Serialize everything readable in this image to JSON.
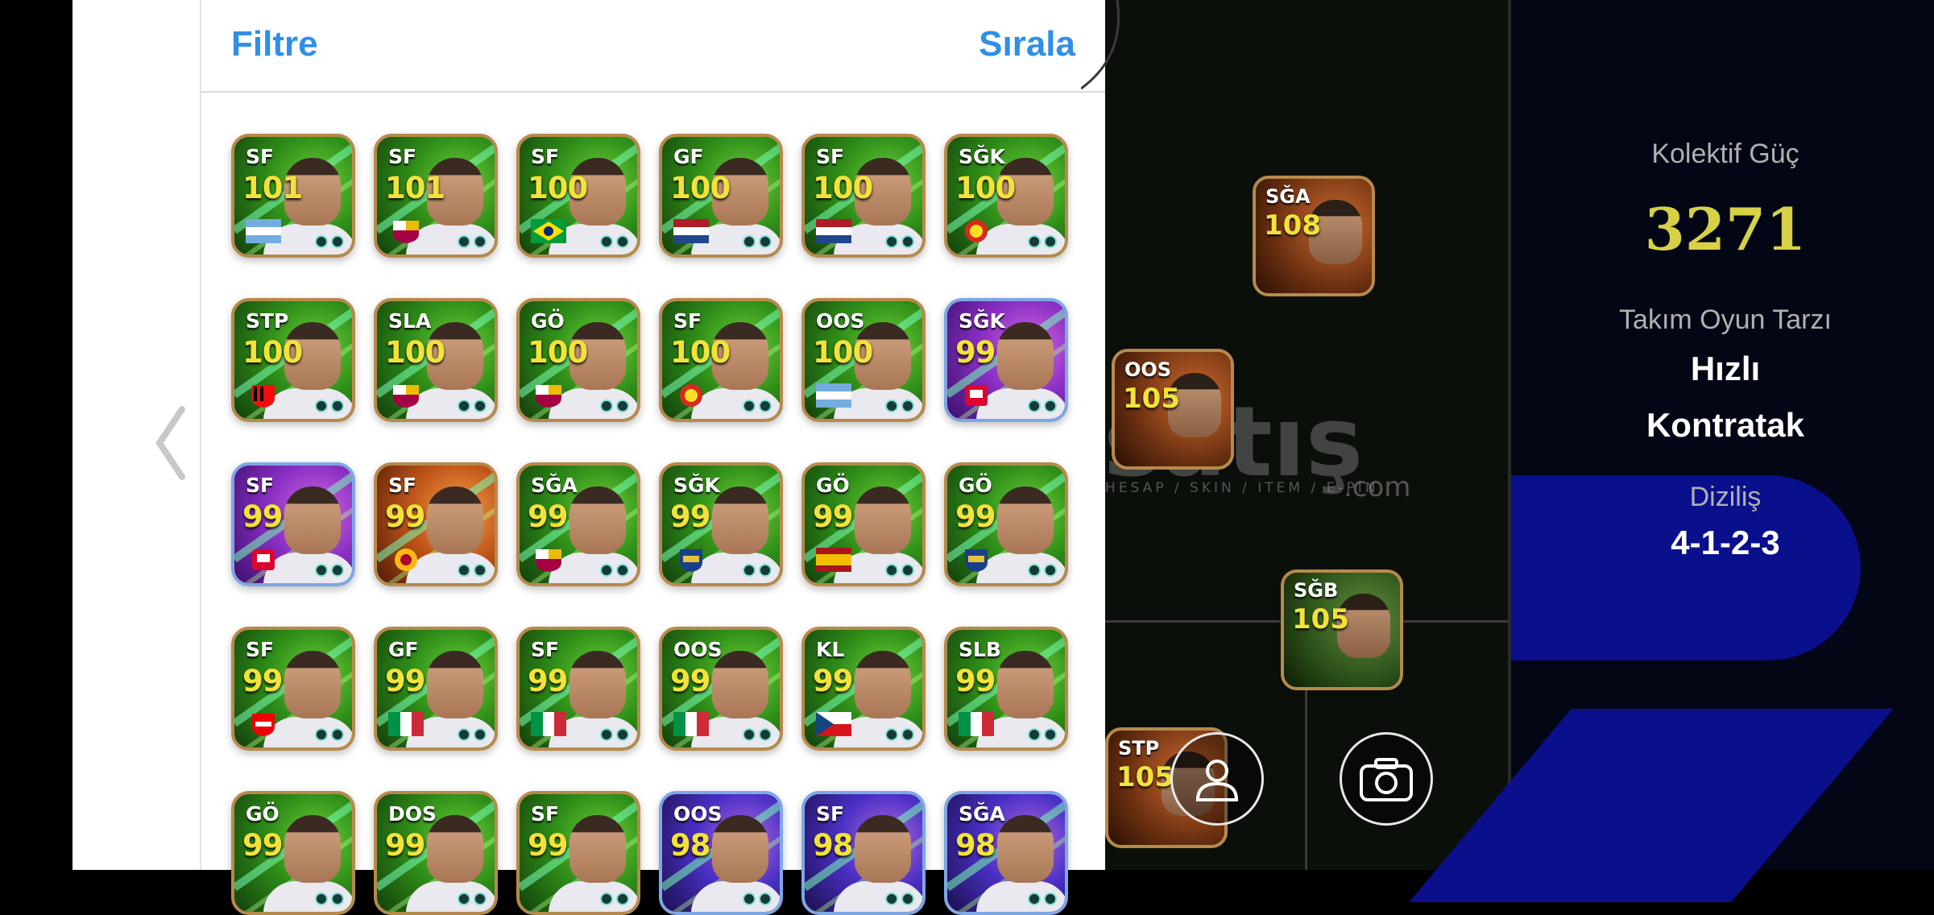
{
  "header": {
    "filter_label": "Filtre",
    "sort_label": "Sırala"
  },
  "players": [
    {
      "pos": "SF",
      "rating": "101",
      "style": "green",
      "flag": "argentina"
    },
    {
      "pos": "SF",
      "rating": "101",
      "style": "green",
      "flag": "barcelona"
    },
    {
      "pos": "SF",
      "rating": "100",
      "style": "green",
      "flag": "brazil"
    },
    {
      "pos": "GF",
      "rating": "100",
      "style": "green",
      "flag": "netherlands"
    },
    {
      "pos": "SF",
      "rating": "100",
      "style": "green",
      "flag": "netherlands"
    },
    {
      "pos": "SĞK",
      "rating": "100",
      "style": "green",
      "flag": "manutd"
    },
    {
      "pos": "STP",
      "rating": "100",
      "style": "green",
      "flag": "milan"
    },
    {
      "pos": "SLA",
      "rating": "100",
      "style": "green",
      "flag": "barcelona"
    },
    {
      "pos": "GÖ",
      "rating": "100",
      "style": "green",
      "flag": "barcelona"
    },
    {
      "pos": "SF",
      "rating": "100",
      "style": "green",
      "flag": "manutd"
    },
    {
      "pos": "OOS",
      "rating": "100",
      "style": "green",
      "flag": "argentina"
    },
    {
      "pos": "SĞK",
      "rating": "99",
      "style": "purple",
      "flag": "bayern"
    },
    {
      "pos": "SF",
      "rating": "99",
      "style": "purple",
      "flag": "bayern"
    },
    {
      "pos": "SF",
      "rating": "99",
      "style": "orange",
      "flag": "galatasaray"
    },
    {
      "pos": "SĞA",
      "rating": "99",
      "style": "green",
      "flag": "barcelona"
    },
    {
      "pos": "SĞK",
      "rating": "99",
      "style": "green",
      "flag": "club"
    },
    {
      "pos": "GÖ",
      "rating": "99",
      "style": "green",
      "flag": "spain"
    },
    {
      "pos": "GÖ",
      "rating": "99",
      "style": "green",
      "flag": "club"
    },
    {
      "pos": "SF",
      "rating": "99",
      "style": "green",
      "flag": "arsenal"
    },
    {
      "pos": "GF",
      "rating": "99",
      "style": "green",
      "flag": "italy"
    },
    {
      "pos": "SF",
      "rating": "99",
      "style": "green",
      "flag": "italy"
    },
    {
      "pos": "OOS",
      "rating": "99",
      "style": "green",
      "flag": "italy"
    },
    {
      "pos": "KL",
      "rating": "99",
      "style": "green",
      "flag": "czech"
    },
    {
      "pos": "SLB",
      "rating": "99",
      "style": "green",
      "flag": "italy"
    },
    {
      "pos": "GÖ",
      "rating": "99",
      "style": "green",
      "flag": "none"
    },
    {
      "pos": "DOS",
      "rating": "99",
      "style": "green",
      "flag": "none"
    },
    {
      "pos": "SF",
      "rating": "99",
      "style": "green",
      "flag": "none"
    },
    {
      "pos": "OOS",
      "rating": "98",
      "style": "blue",
      "flag": "none"
    },
    {
      "pos": "SF",
      "rating": "98",
      "style": "blue",
      "flag": "none"
    },
    {
      "pos": "SĞA",
      "rating": "98",
      "style": "blue",
      "flag": "none"
    }
  ],
  "pitch": {
    "cards": [
      {
        "pos": "SĞA",
        "rating": "108",
        "style": "orange"
      },
      {
        "pos": "OOS",
        "rating": "105",
        "style": "orange"
      },
      {
        "pos": "SĞB",
        "rating": "105",
        "style": "green"
      },
      {
        "pos": "STP",
        "rating": "105",
        "style": "orange"
      }
    ],
    "watermark": "satış",
    "watermark_sub": "HESAP / SKIN / ITEM / E-PIN",
    "watermark_com": ".com"
  },
  "stats": {
    "power_label": "Kolektif Güç",
    "power_value": "3271",
    "style_label": "Takım Oyun Tarzı",
    "style_value_1": "Hızlı",
    "style_value_2": "Kontratak",
    "formation_label": "Diziliş",
    "formation_value": "4-1-2-3"
  },
  "colors": {
    "accent": "#2f8fe8",
    "power": "#d8d046",
    "pill": "#0a0f8c"
  }
}
